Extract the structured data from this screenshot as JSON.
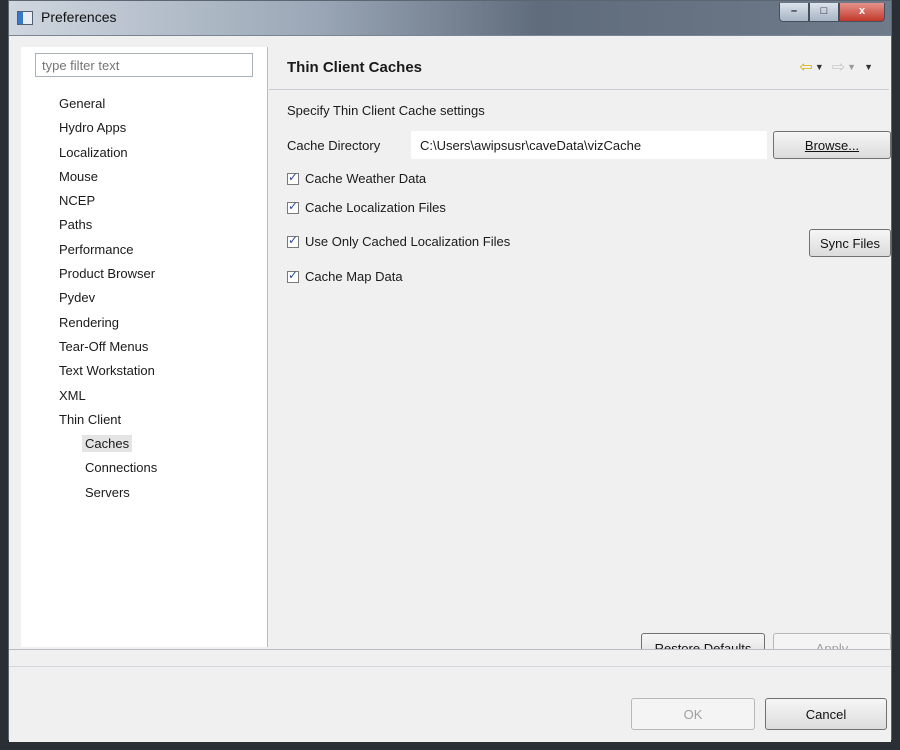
{
  "window": {
    "title": "Preferences",
    "controls": {
      "minimize": "–",
      "maximize": "□",
      "close": "x"
    }
  },
  "sidebar": {
    "filter_placeholder": "type filter text",
    "items": [
      {
        "label": "General"
      },
      {
        "label": "Hydro Apps"
      },
      {
        "label": "Localization"
      },
      {
        "label": "Mouse"
      },
      {
        "label": "NCEP"
      },
      {
        "label": "Paths"
      },
      {
        "label": "Performance"
      },
      {
        "label": "Product Browser"
      },
      {
        "label": "Pydev"
      },
      {
        "label": "Rendering"
      },
      {
        "label": "Tear-Off Menus"
      },
      {
        "label": "Text Workstation"
      },
      {
        "label": "XML"
      },
      {
        "label": "Thin Client"
      }
    ],
    "children": [
      {
        "label": "Caches",
        "selected": true
      },
      {
        "label": "Connections"
      },
      {
        "label": "Servers"
      }
    ]
  },
  "panel": {
    "title": "Thin Client Caches",
    "description": "Specify Thin Client Cache settings",
    "cache_directory": {
      "label": "Cache Directory",
      "value": "C:\\Users\\awipsusr\\caveData\\vizCache"
    },
    "browse_label": "Browse...",
    "checkboxes": [
      {
        "label": "Cache Weather Data",
        "checked": true
      },
      {
        "label": "Cache Localization Files",
        "checked": true
      },
      {
        "label": "Use Only Cached Localization Files",
        "checked": true
      },
      {
        "label": "Cache Map Data",
        "checked": true
      }
    ],
    "sync_label": "Sync Files",
    "restore_defaults_label": "Restore Defaults",
    "apply_label": "Apply"
  },
  "footer": {
    "ok_label": "OK",
    "cancel_label": "Cancel"
  },
  "colors": {
    "nav_arrow": "#d9b300",
    "checkbox_tick": "#2a4a9a",
    "window_bg": "#f0f0f0"
  }
}
